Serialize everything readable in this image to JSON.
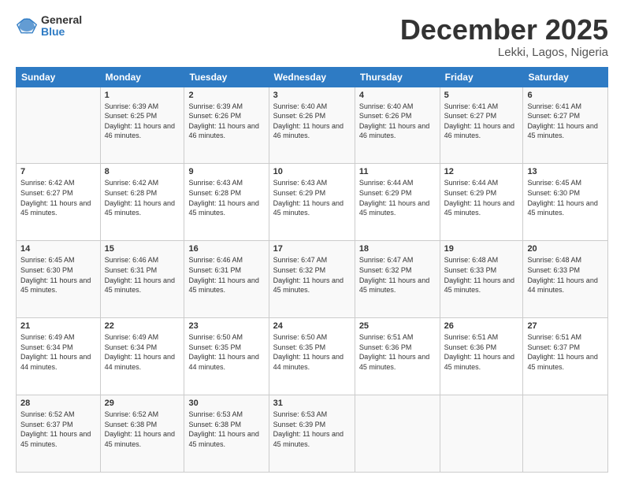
{
  "logo": {
    "general": "General",
    "blue": "Blue"
  },
  "header": {
    "month": "December 2025",
    "location": "Lekki, Lagos, Nigeria"
  },
  "weekdays": [
    "Sunday",
    "Monday",
    "Tuesday",
    "Wednesday",
    "Thursday",
    "Friday",
    "Saturday"
  ],
  "weeks": [
    [
      {
        "day": "",
        "sunrise": "",
        "sunset": "",
        "daylight": ""
      },
      {
        "day": "1",
        "sunrise": "Sunrise: 6:39 AM",
        "sunset": "Sunset: 6:25 PM",
        "daylight": "Daylight: 11 hours and 46 minutes."
      },
      {
        "day": "2",
        "sunrise": "Sunrise: 6:39 AM",
        "sunset": "Sunset: 6:26 PM",
        "daylight": "Daylight: 11 hours and 46 minutes."
      },
      {
        "day": "3",
        "sunrise": "Sunrise: 6:40 AM",
        "sunset": "Sunset: 6:26 PM",
        "daylight": "Daylight: 11 hours and 46 minutes."
      },
      {
        "day": "4",
        "sunrise": "Sunrise: 6:40 AM",
        "sunset": "Sunset: 6:26 PM",
        "daylight": "Daylight: 11 hours and 46 minutes."
      },
      {
        "day": "5",
        "sunrise": "Sunrise: 6:41 AM",
        "sunset": "Sunset: 6:27 PM",
        "daylight": "Daylight: 11 hours and 46 minutes."
      },
      {
        "day": "6",
        "sunrise": "Sunrise: 6:41 AM",
        "sunset": "Sunset: 6:27 PM",
        "daylight": "Daylight: 11 hours and 45 minutes."
      }
    ],
    [
      {
        "day": "7",
        "sunrise": "Sunrise: 6:42 AM",
        "sunset": "Sunset: 6:27 PM",
        "daylight": "Daylight: 11 hours and 45 minutes."
      },
      {
        "day": "8",
        "sunrise": "Sunrise: 6:42 AM",
        "sunset": "Sunset: 6:28 PM",
        "daylight": "Daylight: 11 hours and 45 minutes."
      },
      {
        "day": "9",
        "sunrise": "Sunrise: 6:43 AM",
        "sunset": "Sunset: 6:28 PM",
        "daylight": "Daylight: 11 hours and 45 minutes."
      },
      {
        "day": "10",
        "sunrise": "Sunrise: 6:43 AM",
        "sunset": "Sunset: 6:29 PM",
        "daylight": "Daylight: 11 hours and 45 minutes."
      },
      {
        "day": "11",
        "sunrise": "Sunrise: 6:44 AM",
        "sunset": "Sunset: 6:29 PM",
        "daylight": "Daylight: 11 hours and 45 minutes."
      },
      {
        "day": "12",
        "sunrise": "Sunrise: 6:44 AM",
        "sunset": "Sunset: 6:29 PM",
        "daylight": "Daylight: 11 hours and 45 minutes."
      },
      {
        "day": "13",
        "sunrise": "Sunrise: 6:45 AM",
        "sunset": "Sunset: 6:30 PM",
        "daylight": "Daylight: 11 hours and 45 minutes."
      }
    ],
    [
      {
        "day": "14",
        "sunrise": "Sunrise: 6:45 AM",
        "sunset": "Sunset: 6:30 PM",
        "daylight": "Daylight: 11 hours and 45 minutes."
      },
      {
        "day": "15",
        "sunrise": "Sunrise: 6:46 AM",
        "sunset": "Sunset: 6:31 PM",
        "daylight": "Daylight: 11 hours and 45 minutes."
      },
      {
        "day": "16",
        "sunrise": "Sunrise: 6:46 AM",
        "sunset": "Sunset: 6:31 PM",
        "daylight": "Daylight: 11 hours and 45 minutes."
      },
      {
        "day": "17",
        "sunrise": "Sunrise: 6:47 AM",
        "sunset": "Sunset: 6:32 PM",
        "daylight": "Daylight: 11 hours and 45 minutes."
      },
      {
        "day": "18",
        "sunrise": "Sunrise: 6:47 AM",
        "sunset": "Sunset: 6:32 PM",
        "daylight": "Daylight: 11 hours and 45 minutes."
      },
      {
        "day": "19",
        "sunrise": "Sunrise: 6:48 AM",
        "sunset": "Sunset: 6:33 PM",
        "daylight": "Daylight: 11 hours and 45 minutes."
      },
      {
        "day": "20",
        "sunrise": "Sunrise: 6:48 AM",
        "sunset": "Sunset: 6:33 PM",
        "daylight": "Daylight: 11 hours and 44 minutes."
      }
    ],
    [
      {
        "day": "21",
        "sunrise": "Sunrise: 6:49 AM",
        "sunset": "Sunset: 6:34 PM",
        "daylight": "Daylight: 11 hours and 44 minutes."
      },
      {
        "day": "22",
        "sunrise": "Sunrise: 6:49 AM",
        "sunset": "Sunset: 6:34 PM",
        "daylight": "Daylight: 11 hours and 44 minutes."
      },
      {
        "day": "23",
        "sunrise": "Sunrise: 6:50 AM",
        "sunset": "Sunset: 6:35 PM",
        "daylight": "Daylight: 11 hours and 44 minutes."
      },
      {
        "day": "24",
        "sunrise": "Sunrise: 6:50 AM",
        "sunset": "Sunset: 6:35 PM",
        "daylight": "Daylight: 11 hours and 44 minutes."
      },
      {
        "day": "25",
        "sunrise": "Sunrise: 6:51 AM",
        "sunset": "Sunset: 6:36 PM",
        "daylight": "Daylight: 11 hours and 45 minutes."
      },
      {
        "day": "26",
        "sunrise": "Sunrise: 6:51 AM",
        "sunset": "Sunset: 6:36 PM",
        "daylight": "Daylight: 11 hours and 45 minutes."
      },
      {
        "day": "27",
        "sunrise": "Sunrise: 6:51 AM",
        "sunset": "Sunset: 6:37 PM",
        "daylight": "Daylight: 11 hours and 45 minutes."
      }
    ],
    [
      {
        "day": "28",
        "sunrise": "Sunrise: 6:52 AM",
        "sunset": "Sunset: 6:37 PM",
        "daylight": "Daylight: 11 hours and 45 minutes."
      },
      {
        "day": "29",
        "sunrise": "Sunrise: 6:52 AM",
        "sunset": "Sunset: 6:38 PM",
        "daylight": "Daylight: 11 hours and 45 minutes."
      },
      {
        "day": "30",
        "sunrise": "Sunrise: 6:53 AM",
        "sunset": "Sunset: 6:38 PM",
        "daylight": "Daylight: 11 hours and 45 minutes."
      },
      {
        "day": "31",
        "sunrise": "Sunrise: 6:53 AM",
        "sunset": "Sunset: 6:39 PM",
        "daylight": "Daylight: 11 hours and 45 minutes."
      },
      {
        "day": "",
        "sunrise": "",
        "sunset": "",
        "daylight": ""
      },
      {
        "day": "",
        "sunrise": "",
        "sunset": "",
        "daylight": ""
      },
      {
        "day": "",
        "sunrise": "",
        "sunset": "",
        "daylight": ""
      }
    ]
  ]
}
